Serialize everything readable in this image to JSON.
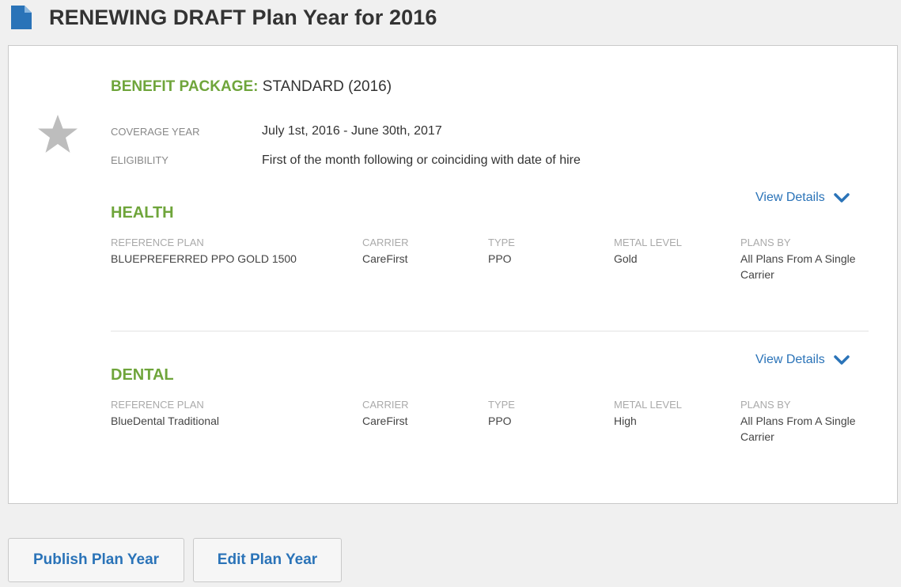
{
  "header": {
    "title": "RENEWING DRAFT Plan Year for 2016",
    "icon": "document-icon",
    "icon_color": "#2a73b8"
  },
  "package": {
    "label": "BENEFIT PACKAGE:",
    "name": "STANDARD (2016)",
    "star_icon": "star-icon",
    "coverage_year_label": "COVERAGE YEAR",
    "coverage_year_value": "July 1st, 2016 - June 30th, 2017",
    "eligibility_label": "ELIGIBILITY",
    "eligibility_value": "First of the month following or coinciding with date of hire"
  },
  "columns": {
    "reference_plan": "REFERENCE PLAN",
    "carrier": "CARRIER",
    "type": "TYPE",
    "metal_level": "METAL LEVEL",
    "plans_by": "PLANS BY"
  },
  "health": {
    "title": "HEALTH",
    "view_details": "View Details",
    "reference_plan": "BLUEPREFERRED PPO GOLD 1500",
    "carrier": "CareFirst",
    "type": "PPO",
    "metal_level": "Gold",
    "plans_by_line1": "All Plans From A Single",
    "plans_by_line2": "Carrier"
  },
  "dental": {
    "title": "DENTAL",
    "view_details": "View Details",
    "reference_plan": "BlueDental Traditional",
    "carrier": "CareFirst",
    "type": "PPO",
    "metal_level": "High",
    "plans_by_line1": "All Plans From A Single",
    "plans_by_line2": "Carrier"
  },
  "actions": {
    "publish_label": "Publish Plan Year",
    "edit_label": "Edit Plan Year"
  },
  "colors": {
    "accent_green": "#6fa53b",
    "link_blue": "#2a73b8"
  }
}
